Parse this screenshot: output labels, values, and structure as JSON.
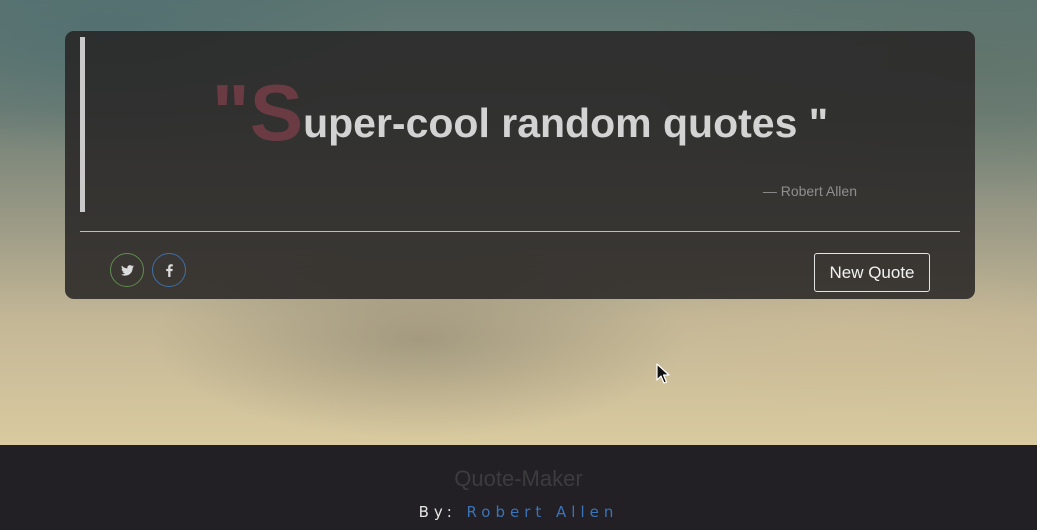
{
  "quote": {
    "open_mark": "\"",
    "drop_letter": "S",
    "text": "uper-cool random quotes \"",
    "author": "— Robert Allen"
  },
  "share": {
    "twitter_icon": "twitter-icon",
    "facebook_icon": "facebook-icon"
  },
  "actions": {
    "new_quote_label": "New Quote"
  },
  "footer": {
    "title": "Quote-Maker",
    "by_label": "By:",
    "author_link": "Robert Allen"
  },
  "colors": {
    "accent_quote": "#6b3b44",
    "link": "#3b73b9",
    "twitter_ring": "#5f8c4f",
    "facebook_ring": "#3f6fa6"
  }
}
